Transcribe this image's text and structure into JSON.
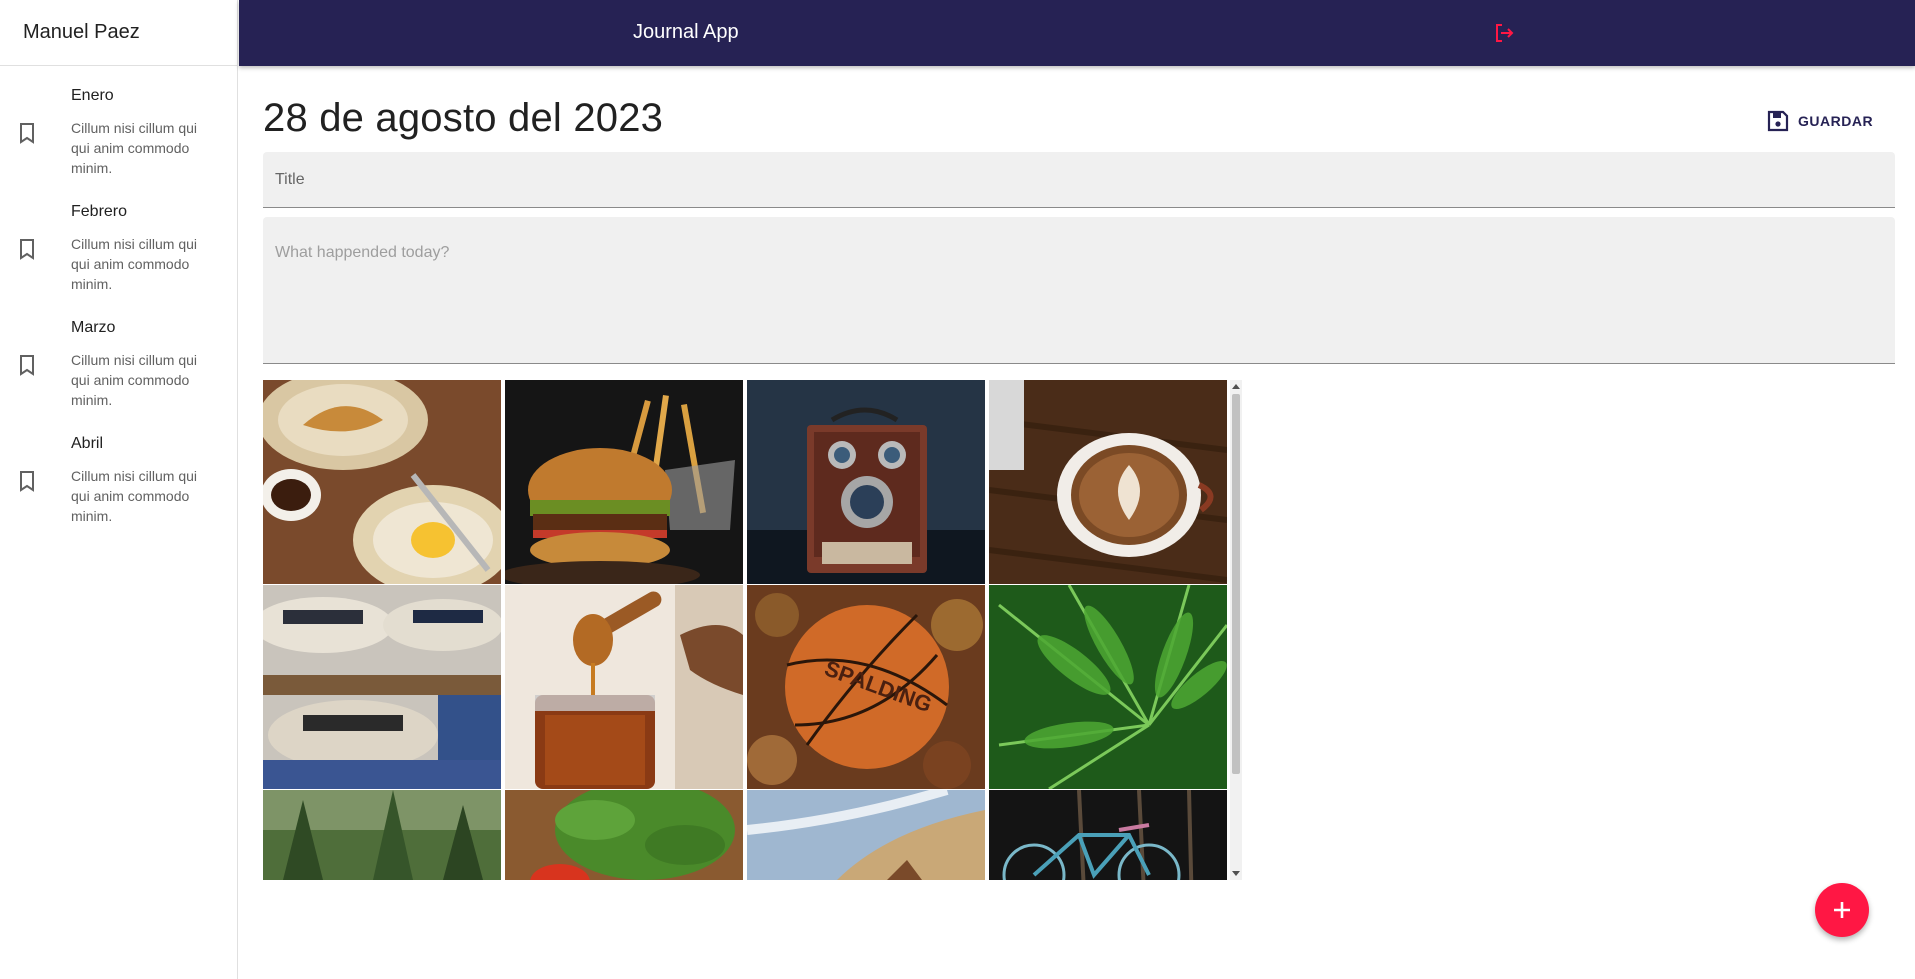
{
  "app": {
    "title": "Journal App",
    "user_name": "Manuel Paez",
    "colors": {
      "appbar": "#262254",
      "accent": "#ff1744",
      "field_bg": "#f0f0f0"
    }
  },
  "sidebar": {
    "entries": [
      {
        "title": "Enero",
        "text": "Cillum nisi cillum qui qui anim commodo minim.",
        "icon": "bookmark-icon"
      },
      {
        "title": "Febrero",
        "text": "Cillum nisi cillum qui qui anim commodo minim.",
        "icon": "bookmark-icon"
      },
      {
        "title": "Marzo",
        "text": "Cillum nisi cillum qui qui anim commodo minim.",
        "icon": "bookmark-icon"
      },
      {
        "title": "Abril",
        "text": "Cillum nisi cillum qui qui anim commodo minim.",
        "icon": "bookmark-icon"
      }
    ]
  },
  "appbar": {
    "logout_icon": "logout-icon"
  },
  "note": {
    "date": "28 de agosto del 2023",
    "save_label": "GUARDAR",
    "title_placeholder": "Title",
    "body_placeholder": "What happended today?"
  },
  "gallery": {
    "images": [
      "breakfast-plates",
      "burger-fries",
      "vintage-camera",
      "latte-art",
      "straw-hats",
      "honey-jar",
      "spalding-basketball",
      "fern-leaves",
      "forest",
      "basil-tomato",
      "beach-wave",
      "bicycle"
    ]
  },
  "fab": {
    "icon": "plus-icon"
  }
}
